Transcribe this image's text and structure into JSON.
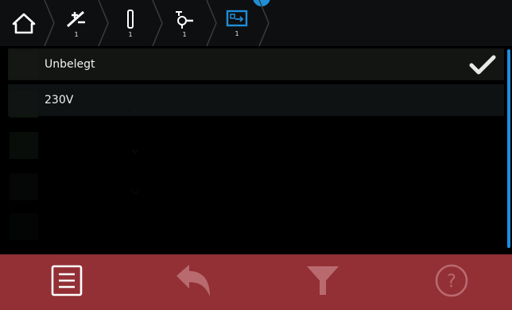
{
  "breadcrumb": {
    "items": [
      {
        "icon": "home-icon",
        "count": ""
      },
      {
        "icon": "voltage-off-icon",
        "count": "1"
      },
      {
        "icon": "fuse-icon",
        "count": "1"
      },
      {
        "icon": "lamp-icon",
        "count": "1"
      },
      {
        "icon": "output-terminal-icon",
        "count": "1"
      }
    ]
  },
  "list": {
    "options": [
      {
        "label": "Unbelegt",
        "selected": true
      },
      {
        "label": "230V",
        "selected": false
      }
    ]
  },
  "toolbar": {
    "buttons": [
      {
        "icon": "menu-list-icon",
        "enabled": true
      },
      {
        "icon": "undo-icon",
        "enabled": false
      },
      {
        "icon": "filter-icon",
        "enabled": false
      },
      {
        "icon": "help-icon",
        "enabled": false
      }
    ]
  },
  "colors": {
    "toolbar_bg": "#923036",
    "accent_blue": "#1d8fe1"
  }
}
